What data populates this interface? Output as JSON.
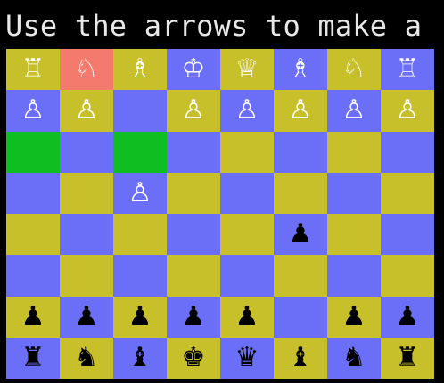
{
  "terminal": {
    "prompt_text": "Use the arrows to make a"
  },
  "colors": {
    "light_square": "#c8c02a",
    "dark_square": "#6b6ef7",
    "selected_square": "#f47a6e",
    "target_square": "#0fbf22",
    "white_piece": "#ffffff",
    "black_piece": "#000000"
  },
  "board": {
    "rows": [
      [
        "♖",
        "♘",
        "♗",
        "♔",
        "♕",
        "♗",
        "♘",
        "♖"
      ],
      [
        "♙",
        "♙",
        "",
        "♙",
        "♙",
        "♙",
        "♙",
        "♙"
      ],
      [
        "",
        "",
        "",
        "",
        "",
        "",
        "",
        ""
      ],
      [
        "",
        "",
        "♙",
        "",
        "",
        "",
        "",
        ""
      ],
      [
        "",
        "",
        "",
        "",
        "",
        "♟",
        "",
        ""
      ],
      [
        "",
        "",
        "",
        "",
        "",
        "",
        "",
        ""
      ],
      [
        "♟",
        "♟",
        "♟",
        "♟",
        "♟",
        "",
        "♟",
        "♟"
      ],
      [
        "♜",
        "♞",
        "♝",
        "♚",
        "♛",
        "♝",
        "♞",
        "♜"
      ]
    ],
    "piece_sides": [
      [
        "white",
        "white",
        "white",
        "white",
        "white",
        "white",
        "white",
        "white"
      ],
      [
        "white",
        "white",
        "",
        "white",
        "white",
        "white",
        "white",
        "white"
      ],
      [
        "",
        "",
        "",
        "",
        "",
        "",
        "",
        ""
      ],
      [
        "",
        "",
        "white",
        "",
        "",
        "",
        "",
        ""
      ],
      [
        "",
        "",
        "",
        "",
        "",
        "black",
        "",
        ""
      ],
      [
        "",
        "",
        "",
        "",
        "",
        "",
        "",
        ""
      ],
      [
        "black",
        "black",
        "black",
        "black",
        "black",
        "",
        "black",
        "black"
      ],
      [
        "black",
        "black",
        "black",
        "black",
        "black",
        "black",
        "black",
        "black"
      ]
    ],
    "highlights": [
      {
        "row": 0,
        "col": 1,
        "kind": "selected"
      },
      {
        "row": 2,
        "col": 0,
        "kind": "target"
      },
      {
        "row": 2,
        "col": 2,
        "kind": "target"
      }
    ]
  }
}
